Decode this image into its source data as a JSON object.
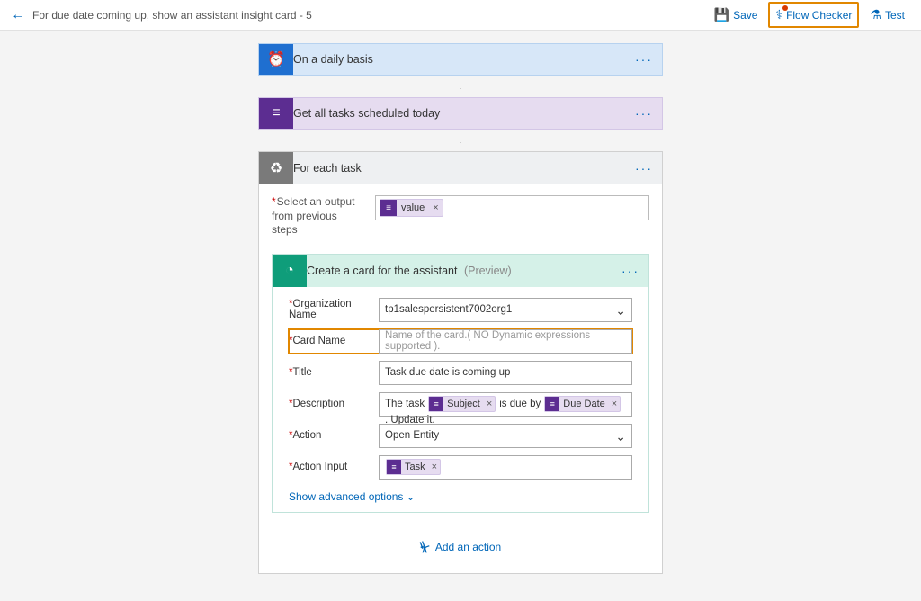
{
  "header": {
    "title": "For due date coming up, show an assistant insight card - 5",
    "actions": {
      "save": "Save",
      "flow_checker": "Flow Checker",
      "test": "Test"
    }
  },
  "steps": {
    "schedule": {
      "title": "On a daily basis"
    },
    "getTasks": {
      "title": "Get all tasks scheduled today"
    },
    "forEach": {
      "title": "For each task",
      "selectLabel": "Select an output from previous steps",
      "valueToken": "value"
    },
    "createCard": {
      "title": "Create a card for the assistant",
      "preview": "(Preview)",
      "fields": {
        "orgName": {
          "label": "Organization Name",
          "value": "tp1salespersistent7002org1"
        },
        "cardName": {
          "label": "Card Name",
          "placeholder": "Name of the card.( NO Dynamic expressions supported )."
        },
        "titleField": {
          "label": "Title",
          "value": "Task due date is coming up"
        },
        "description": {
          "label": "Description",
          "textBefore": "The task",
          "chip1": "Subject",
          "textMid": "is due by",
          "chip2": "Due Date",
          "textAfter": ". Update it."
        },
        "action": {
          "label": "Action",
          "value": "Open Entity"
        },
        "actionInput": {
          "label": "Action Input",
          "chip": "Task"
        }
      },
      "advanced": "Show advanced options"
    },
    "addAction": "Add an action"
  }
}
